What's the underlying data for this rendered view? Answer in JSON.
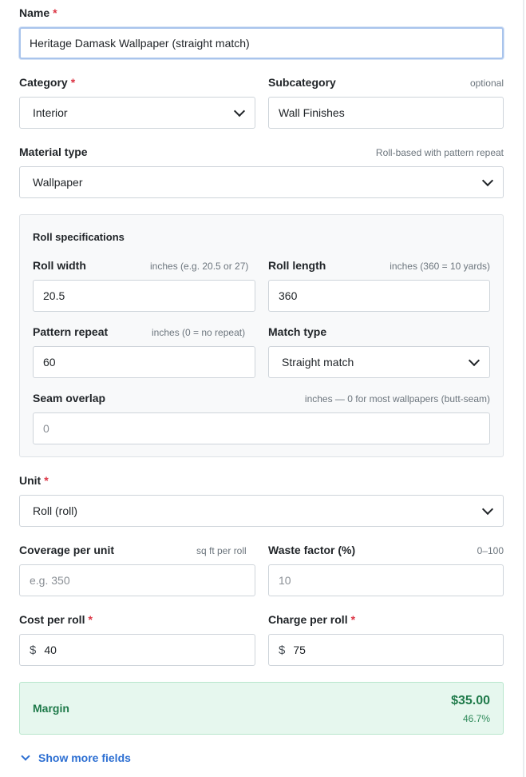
{
  "fields": {
    "name": {
      "label": "Name",
      "value": "Heritage Damask Wallpaper (straight match)",
      "required_mark": "*"
    },
    "category": {
      "label": "Category",
      "value": "Interior",
      "required_mark": "*"
    },
    "subcategory": {
      "label": "Subcategory",
      "hint": "optional",
      "value": "Wall Finishes"
    },
    "material_type": {
      "label": "Material type",
      "hint": "Roll-based with pattern repeat",
      "value": "Wallpaper"
    },
    "unit": {
      "label": "Unit",
      "value": "Roll (roll)",
      "required_mark": "*"
    },
    "coverage": {
      "label": "Coverage per unit",
      "hint": "sq ft per roll",
      "placeholder": "e.g. 350"
    },
    "waste": {
      "label": "Waste factor (%)",
      "hint": "0–100",
      "placeholder": "10"
    },
    "cost": {
      "label": "Cost per roll",
      "value": "40",
      "currency": "$",
      "required_mark": "*"
    },
    "charge": {
      "label": "Charge per roll",
      "value": "75",
      "currency": "$",
      "required_mark": "*"
    }
  },
  "roll_specs": {
    "title": "Roll specifications",
    "roll_width": {
      "label": "Roll width",
      "hint": "inches (e.g. 20.5 or 27)",
      "value": "20.5"
    },
    "roll_length": {
      "label": "Roll length",
      "hint": "inches (360 = 10 yards)",
      "value": "360"
    },
    "pattern_repeat": {
      "label": "Pattern repeat",
      "hint": "inches (0 = no repeat)",
      "value": "60"
    },
    "match_type": {
      "label": "Match type",
      "value": "Straight match"
    },
    "seam_overlap": {
      "label": "Seam overlap",
      "hint": "inches — 0 for most wallpapers (butt-seam)",
      "placeholder": "0"
    }
  },
  "margin": {
    "label": "Margin",
    "amount": "$35.00",
    "percent": "46.7%"
  },
  "show_more": {
    "label": "Show more fields"
  },
  "colors": {
    "accent": "#2d6fd2",
    "required": "#dc3545",
    "margin_bg": "#e6f7ee",
    "margin_text": "#1f7a4a"
  }
}
